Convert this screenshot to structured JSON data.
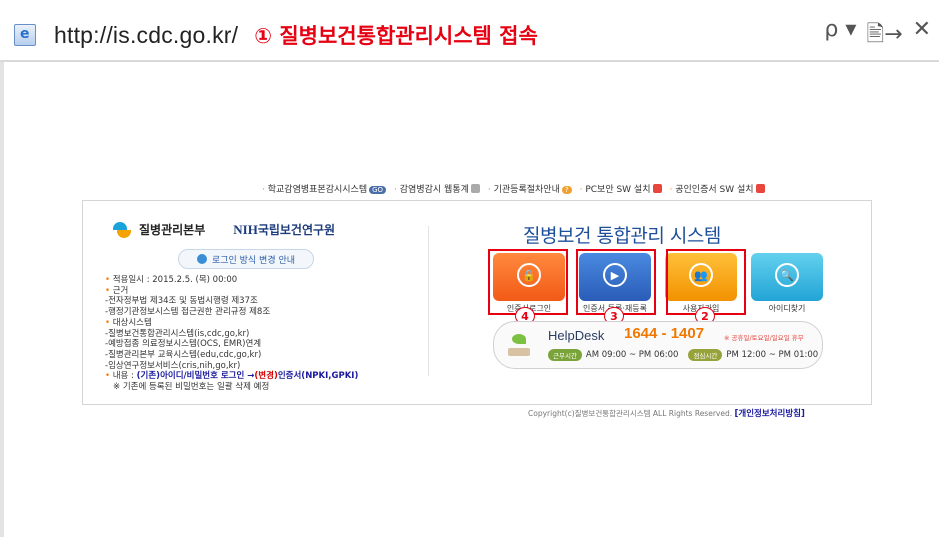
{
  "browser": {
    "url": "http://is.cdc.go.kr/",
    "annotation": "① 질병보건통합관리시스템 접속",
    "tools": [
      "ρ ▾",
      "🖹→",
      "✕"
    ]
  },
  "top_links": [
    {
      "label": "학교감염병표본감시시스템",
      "badge": "GO"
    },
    {
      "label": "감염병감시 웹통계",
      "badge": ""
    },
    {
      "label": "기관등록절차안내",
      "badge": "?"
    },
    {
      "label": "PC보안 SW 설치",
      "badge": ""
    },
    {
      "label": "공인인증서 SW 설치",
      "badge": ""
    }
  ],
  "logos": {
    "kcdc": "질병관리본부",
    "nih_prefix": "NIH",
    "nih": "국립보건연구원"
  },
  "login_change_button": "로그인 방식 변경 안내",
  "notice": {
    "date": "적용일시 : 2015.2.5. (목) 00:00",
    "basis": "근거",
    "basis_1": "-전자정부법 제34조 및 동법시행령 제37조",
    "basis_2": "-행정기관정보시스템 접근권한 관리규정 제8조",
    "target": "대상시스템",
    "target_1": "-질병보건통합관리시스템(is,cdc,go,kr)",
    "target_2": "-예방접종 의료정보시스템(OCS, EMR)연계",
    "target_3": "-질병관리본부 교육시스템(edu,cdc,go,kr)",
    "target_4": "-임상연구정보서비스(cris,nih,go,kr)",
    "content_prefix": "내용 : ",
    "content_old": "(기존)",
    "content_mid": "아이디/비밀번호 로그인 →",
    "content_new": "(변경)",
    "content_end": "인증서(NPKI,GPKI)",
    "content_note": "※ 기존에 등록된 비밀번호는 일괄 삭제 예정"
  },
  "system_title": "질병보건 통합관리 시스템",
  "buttons": [
    {
      "label": "인증서로그인",
      "icon": "lock-icon",
      "glyph": "🔒"
    },
    {
      "label": "인증서 등록·재등록",
      "icon": "certificate-icon",
      "glyph": "▶"
    },
    {
      "label": "사용자가입",
      "icon": "users-icon",
      "glyph": "👥"
    },
    {
      "label": "아이디찾기",
      "icon": "search-icon",
      "glyph": "🔍"
    }
  ],
  "annotations": {
    "n4": "4",
    "n3": "3",
    "n2": "2"
  },
  "helpdesk": {
    "title": "HelpDesk",
    "phone": "1644 - 1407",
    "note": "※ 공휴일/토요일/일요일 휴무",
    "work_label": "근무시간",
    "work_hours": "AM 09:00 ~ PM 06:00",
    "lunch_label": "점심시간",
    "lunch_hours": "PM 12:00 ~ PM 01:00"
  },
  "footer": {
    "copyright": "Copyright(c)질병보건통합관리시스템 ALL Rights Reserved.",
    "privacy": "[개인정보처리방침]"
  },
  "colors": {
    "annotation_red": "#e60012",
    "title_blue": "#1e4f9a",
    "phone_orange": "#f07800"
  }
}
